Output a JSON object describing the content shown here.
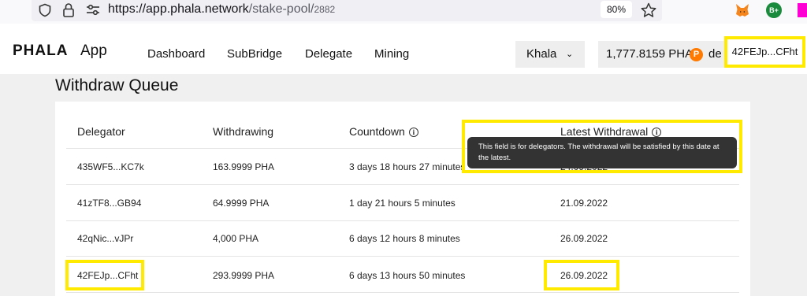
{
  "browser": {
    "url_host": "https://app.phala.network",
    "url_path": "/stake-pool/",
    "url_id": "2882",
    "zoom": "80%",
    "extension_badge": "B+"
  },
  "header": {
    "logo": "PHALA",
    "app_label": "App",
    "nav": [
      "Dashboard",
      "SubBridge",
      "Delegate",
      "Mining"
    ],
    "network": "Khala",
    "balance": "1,777.8159 PHA",
    "balance_extra": "de",
    "account": "42FEJp...CFht",
    "pha_icon": "P"
  },
  "page": {
    "title": "Withdraw Queue",
    "columns": [
      "Delegator",
      "Withdrawing",
      "Countdown",
      "Latest Withdrawal"
    ],
    "info_glyph": "i",
    "rows": [
      {
        "delegator": "435WF5...KC7k",
        "withdrawing": "163.9999 PHA",
        "countdown": "3 days 18 hours 27 minutes",
        "latest": "24.09.2022"
      },
      {
        "delegator": "41zTF8...GB94",
        "withdrawing": "64.9999 PHA",
        "countdown": "1 day 21 hours 5 minutes",
        "latest": "21.09.2022"
      },
      {
        "delegator": "42qNic...vJPr",
        "withdrawing": "4,000 PHA",
        "countdown": "6 days 12 hours 8 minutes",
        "latest": "26.09.2022"
      },
      {
        "delegator": "42FEJp...CFht",
        "withdrawing": "293.9999 PHA",
        "countdown": "6 days 13 hours 50 minutes",
        "latest": "26.09.2022"
      }
    ],
    "tooltip": "This field is for delegators. The withdrawal will be satisfied by this date at the latest."
  },
  "colors": {
    "highlight": "#ffea00",
    "tooltip_bg": "#333333",
    "pha_orange": "#ff7a00"
  }
}
